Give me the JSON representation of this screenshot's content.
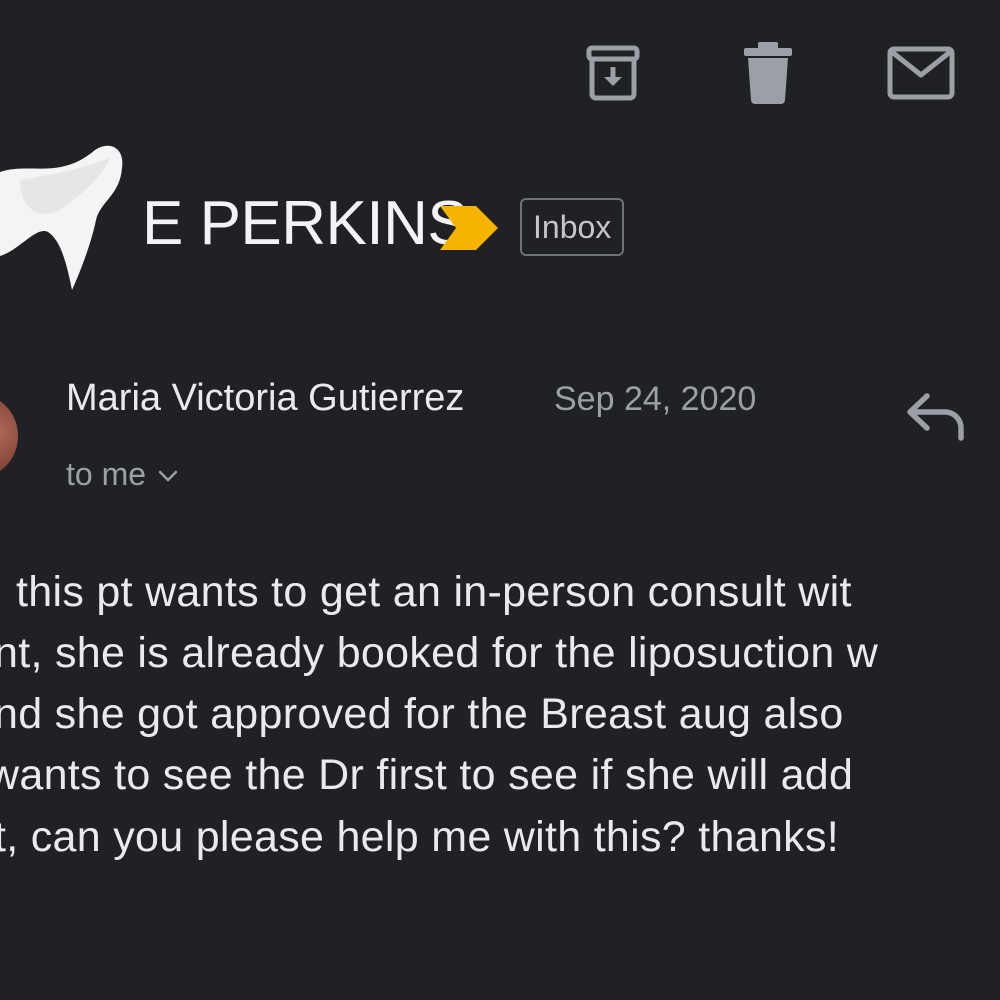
{
  "toolbar": {
    "archive_icon": "archive-icon",
    "delete_icon": "trash-icon",
    "mark_unread_icon": "mail-icon",
    "icon_color": "#9aa0a6"
  },
  "email": {
    "subject": "E PERKINS",
    "importance_marker_color": "#f6b400",
    "label": "Inbox",
    "sender": "Maria Victoria Gutierrez",
    "date": "Sep 24, 2020",
    "recipient": "to me",
    "body_lines": [
      "this pt wants to get an in-person consult wit",
      "nt, she is already booked for the liposuction w",
      "nd she got approved for the Breast aug also",
      "wants to see the Dr first to see if she will add",
      "t, can you please help me with this? thanks!"
    ]
  }
}
